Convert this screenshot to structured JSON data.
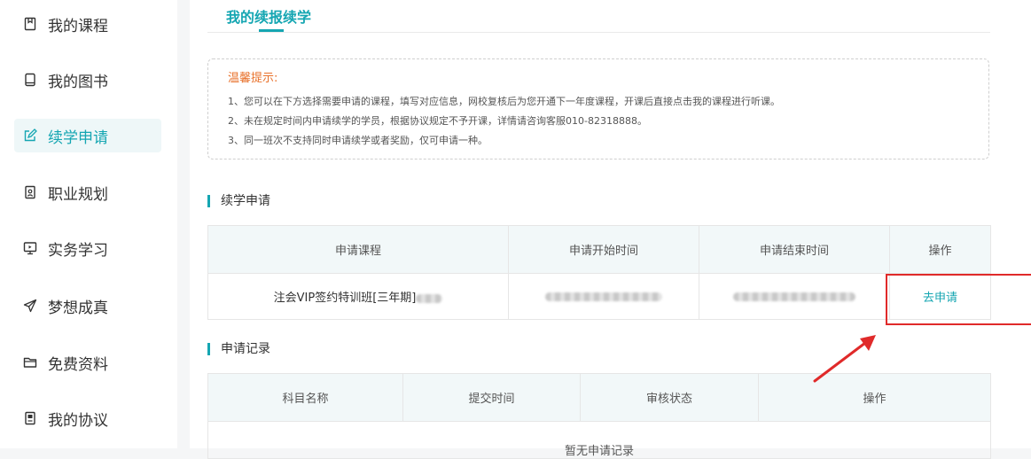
{
  "sidebar": {
    "items": [
      {
        "label": "我的课程",
        "icon": "bookmark-icon"
      },
      {
        "label": "我的图书",
        "icon": "book-icon"
      },
      {
        "label": "续学申请",
        "icon": "edit-icon",
        "active": true
      },
      {
        "label": "职业规划",
        "icon": "career-icon"
      },
      {
        "label": "实务学习",
        "icon": "monitor-icon"
      },
      {
        "label": "梦想成真",
        "icon": "paper-plane-icon"
      },
      {
        "label": "免费资料",
        "icon": "folder-icon"
      },
      {
        "label": "我的协议",
        "icon": "document-icon"
      }
    ]
  },
  "header": {
    "tab_label": "我的续报续学"
  },
  "notice": {
    "title": "温馨提示:",
    "lines": [
      "1、您可以在下方选择需要申请的课程，填写对应信息，网校复核后为您开通下一年度课程，开课后直接点击我的课程进行听课。",
      "2、未在规定时间内申请续学的学员，根据协议规定不予开课，详情请咨询客服010-82318888。",
      "3、同一班次不支持同时申请续学或者奖励，仅可申请一种。"
    ]
  },
  "apply_section": {
    "title": "续学申请",
    "columns": [
      "申请课程",
      "申请开始时间",
      "申请结束时间",
      "操作"
    ],
    "row": {
      "course": "注会VIP签约特训班[三年期]",
      "action": "去申请"
    }
  },
  "records_section": {
    "title": "申请记录",
    "columns": [
      "科目名称",
      "提交时间",
      "审核状态",
      "操作"
    ],
    "empty_text": "暂无申请记录"
  },
  "colors": {
    "accent": "#15a6b2",
    "warning": "#e8712b",
    "annotation": "#e02a2a"
  }
}
